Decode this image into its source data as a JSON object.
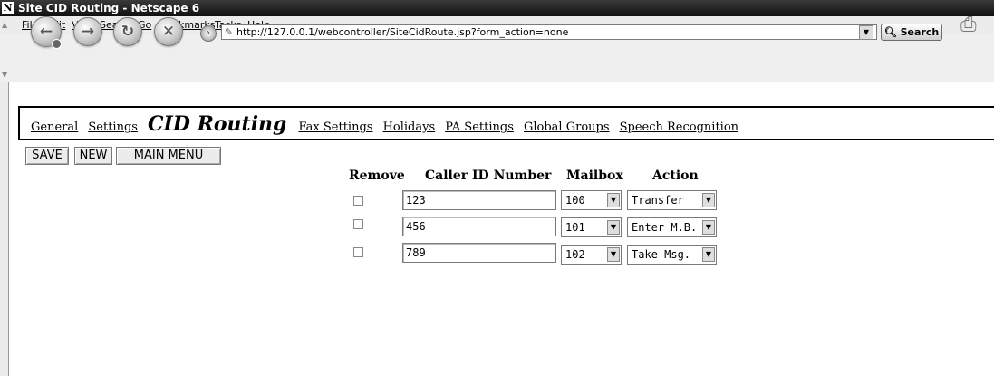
{
  "window": {
    "title": "Site CID Routing - Netscape 6",
    "app_icon": "N"
  },
  "menu": [
    "File",
    "Edit",
    "View",
    "Search",
    "Go",
    "Bookmarks",
    "Tasks",
    "Help"
  ],
  "toolbar": {
    "url": "http://127.0.0.1/webcontroller/SiteCidRoute.jsp?form_action=none",
    "search_label": "Search"
  },
  "tabs": [
    "General",
    "Settings",
    "CID Routing",
    "Fax Settings",
    "Holidays",
    "PA Settings",
    "Global Groups",
    "Speech Recognition"
  ],
  "active_tab": "CID Routing",
  "buttons": {
    "save": "SAVE",
    "new": "NEW",
    "main_menu": "MAIN MENU"
  },
  "table": {
    "headers": {
      "remove": "Remove",
      "caller_id": "Caller ID Number",
      "mailbox": "Mailbox",
      "action": "Action"
    },
    "rows": [
      {
        "remove": false,
        "caller_id": "123",
        "mailbox": "100",
        "action": "Transfer"
      },
      {
        "remove": false,
        "caller_id": "456",
        "mailbox": "101",
        "action": "Enter M.B."
      },
      {
        "remove": false,
        "caller_id": "789",
        "mailbox": "102",
        "action": "Take Msg."
      }
    ]
  }
}
